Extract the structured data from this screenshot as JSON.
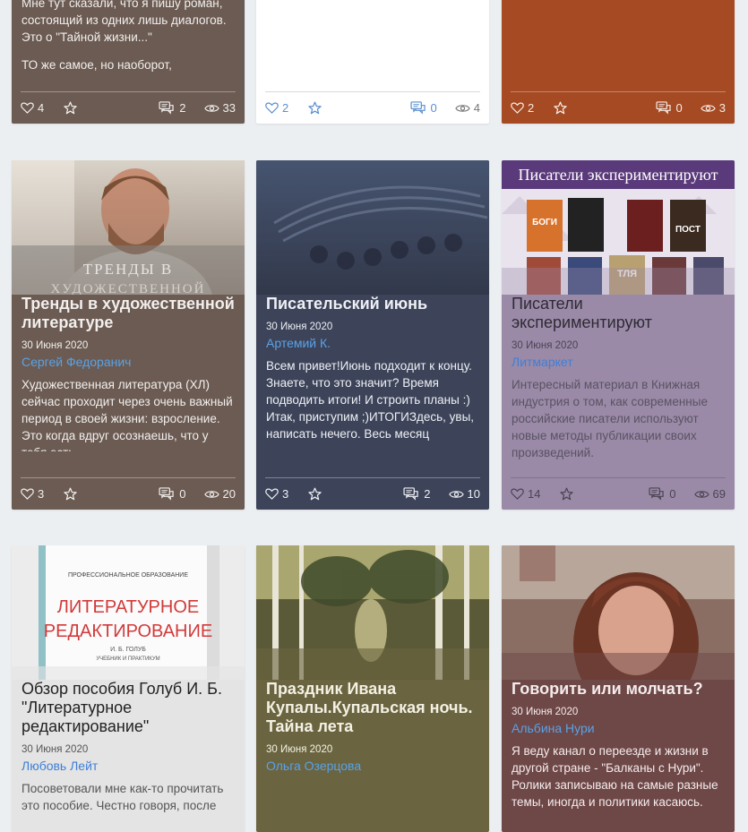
{
  "cards": [
    {
      "excerpt": "Мне тут сказали, что я пишу роман, состоящий из  одних лишь диалогов. Это о \"Тайной жизни...\"",
      "excerpt2": "ТО же самое, но наоборот,",
      "likes": "4",
      "comments": "2",
      "views": "33"
    },
    {
      "likes": "2",
      "comments": "0",
      "views": "4"
    },
    {
      "likes": "2",
      "comments": "0",
      "views": "3"
    },
    {
      "cover_text": "ТРЕНДЫ В",
      "cover_text2": "ХУДОЖЕСТВЕННОЙ",
      "title": "Тренды в художественной литературе",
      "date": "30 Июня 2020",
      "author": "Сергей Федоранич",
      "excerpt": "Художественная литература (ХЛ) сейчас проходит через очень важный период в своей жизни: взросление. Это когда вдруг осознаешь, что у тебя есть",
      "likes": "3",
      "comments": "0",
      "views": "20"
    },
    {
      "title": "Писательский июнь",
      "date": "30 Июня 2020",
      "author": "Артемий К.",
      "excerpt": "Всем привет!Июнь подходит к концу. Знаете, что это значит? Время подводить итоги! И строить планы :) Итак, приступим ;)ИТОГИЗдесь, увы, написать нечего. Весь месяц",
      "likes": "3",
      "comments": "2",
      "views": "10"
    },
    {
      "cover_banner": "Писатели экспериментируют",
      "book_labels": [
        "БОГИ",
        "ПОСТ",
        "ТЛЯ"
      ],
      "title": "Писатели экспериментируют",
      "date": "30 Июня 2020",
      "author": "Литмаркет",
      "excerpt": "Интересный материал в Книжная индустрия о том, как современные российские писатели используют новые методы публикации своих произведений.",
      "likes": "14",
      "comments": "0",
      "views": "69"
    },
    {
      "cover_top": "ПРОФЕССИОНАЛЬНОЕ ОБРАЗОВАНИЕ",
      "cover_title1": "ЛИТЕРАТУРНОЕ",
      "cover_title2": "РЕДАКТИРОВАНИЕ",
      "cover_author": "И. Б. ГОЛУБ",
      "cover_sub": "УЧЕБНИК И ПРАКТИКУМ",
      "title": "Обзор пособия Голуб И. Б. \"Литературное редактирование\"",
      "date": "30 Июня 2020",
      "author": "Любовь Лейт",
      "excerpt": "Посоветовали мне как-то прочитать это пособие. Честно говоря, после"
    },
    {
      "title": "Праздник Ивана Купалы.Купальская ночь. Тайна лета",
      "date": "30 Июня 2020",
      "author": "Ольга Озерцова"
    },
    {
      "title": "Говорить или молчать?",
      "date": "30 Июня 2020",
      "author": "Альбина Нури",
      "excerpt": "Я веду канал о переезде и жизни в другой стране - \"Балканы с Нури\". Ролики записываю на самые разные темы, иногда и политики касаюсь."
    }
  ],
  "colors": {
    "page_bg": "#eceff2",
    "card_brown": "#6b5b52",
    "card_navy": "#3d4459",
    "card_lilac": "#9a8aa8",
    "card_rust": "#a54a22",
    "card_olive": "#6b6440",
    "card_maroon": "#6e4747",
    "link_blue": "#5aa2e6"
  }
}
